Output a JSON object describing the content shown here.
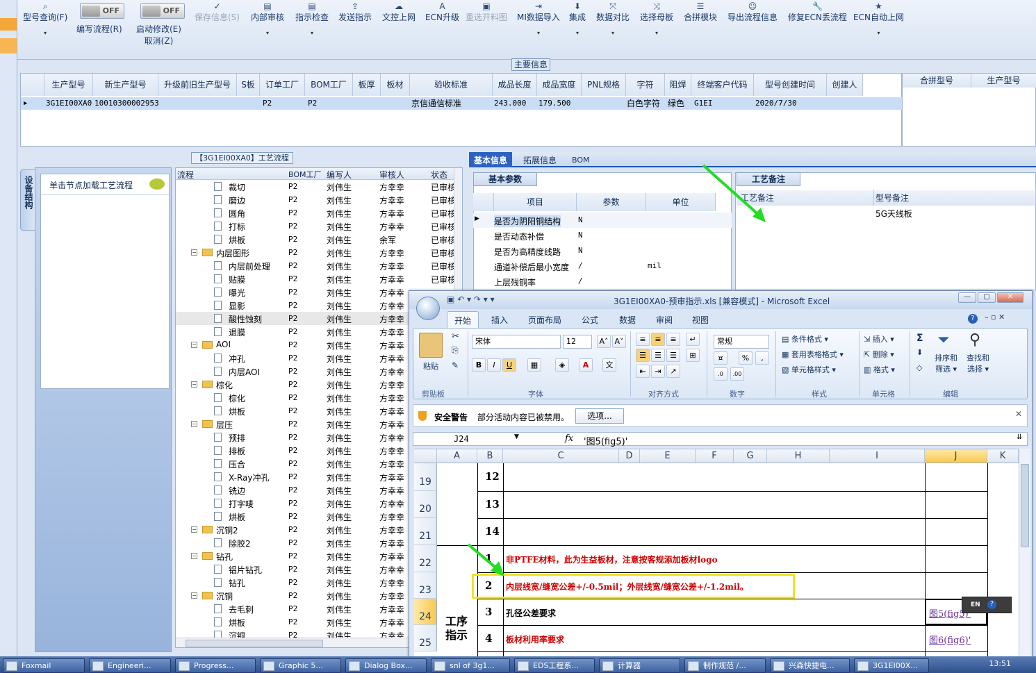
{
  "toolbar": {
    "items": [
      {
        "label": "型号查询(F)",
        "icon": "search-icon"
      },
      {
        "label": "编写流程(R)",
        "icon": "toggle"
      },
      {
        "label": "启动修改(E)",
        "sub": "取消(Z)",
        "icon": "toggle"
      },
      {
        "label": "保存信息(S)",
        "icon": "check-icon",
        "disabled": true
      },
      {
        "label": "内部审核",
        "icon": "print-icon"
      },
      {
        "label": "指示检查",
        "icon": "print-icon"
      },
      {
        "label": "发送指示",
        "icon": "upload-icon"
      },
      {
        "label": "文控上网",
        "icon": "cloud-icon"
      },
      {
        "label": "ECN升级",
        "icon": "letter-a-icon"
      },
      {
        "label": "重选开料图",
        "icon": "image-icon",
        "disabled": true
      },
      {
        "label": "MI数据导入",
        "icon": "import-icon"
      },
      {
        "label": "集成",
        "icon": "download-icon"
      },
      {
        "label": "数据对比",
        "icon": "compare-icon"
      },
      {
        "label": "选择母板",
        "icon": "shuffle-icon"
      },
      {
        "label": "合拼模块",
        "icon": "list-icon"
      },
      {
        "label": "导出流程信息",
        "icon": "smile-icon"
      },
      {
        "label": "修复ECN丢流程",
        "icon": "wrench-icon"
      },
      {
        "label": "ECN自动上网",
        "icon": "star-icon"
      }
    ],
    "toggle_off_label": "OFF"
  },
  "maininfo": {
    "caption": "主要信息",
    "headers": [
      "生产型号",
      "新生产型号",
      "升级前旧生产型号",
      "S板",
      "订单工厂",
      "BOM工厂",
      "板厚",
      "板材",
      "验收标准",
      "成品长度",
      "成品宽度",
      "PNL规格",
      "字符",
      "阻焊",
      "终端客户代码",
      "型号创建时间",
      "创建人"
    ],
    "row": [
      "3G1EI00XA0",
      "10010300002953",
      "",
      "",
      "P2",
      "P2",
      "",
      "",
      "京信通信标准",
      "243.000",
      "179.500",
      "",
      "白色字符",
      "绿色",
      "G1EI",
      "2020/7/30",
      ""
    ],
    "merge_headers": [
      "合拼型号",
      "生产型号"
    ]
  },
  "flow": {
    "caption": "【3G1EI00XA0】工艺流程",
    "vtab_label": "设备结构",
    "left_hint": "单击节点加载工艺流程",
    "headers": [
      "流程",
      "BOM工厂",
      "编写人",
      "审核人",
      "状态"
    ],
    "rows": [
      {
        "name": "裁切",
        "type": "file",
        "level": 2,
        "bom": "P2",
        "writer": "刘伟生",
        "reviewer": "方幸幸",
        "status": "已审核"
      },
      {
        "name": "磨边",
        "type": "file",
        "level": 2,
        "bom": "P2",
        "writer": "刘伟生",
        "reviewer": "方幸幸",
        "status": "已审核"
      },
      {
        "name": "圆角",
        "type": "file",
        "level": 2,
        "bom": "P2",
        "writer": "刘伟生",
        "reviewer": "方幸幸",
        "status": "已审核"
      },
      {
        "name": "打标",
        "type": "file",
        "level": 2,
        "bom": "P2",
        "writer": "刘伟生",
        "reviewer": "方幸幸",
        "status": "已审核"
      },
      {
        "name": "烘板",
        "type": "file",
        "level": 2,
        "bom": "P2",
        "writer": "刘伟生",
        "reviewer": "余军",
        "status": "已审核"
      },
      {
        "name": "内层图形",
        "type": "folder",
        "level": 1,
        "bom": "P2",
        "writer": "刘伟生",
        "reviewer": "方幸幸",
        "status": "已审核"
      },
      {
        "name": "内层前处理",
        "type": "file",
        "level": 2,
        "bom": "P2",
        "writer": "刘伟生",
        "reviewer": "方幸幸",
        "status": "已审核"
      },
      {
        "name": "贴膜",
        "type": "file",
        "level": 2,
        "bom": "P2",
        "writer": "刘伟生",
        "reviewer": "方幸幸",
        "status": "已审核"
      },
      {
        "name": "曝光",
        "type": "file",
        "level": 2,
        "bom": "P2",
        "writer": "刘伟生",
        "reviewer": "方幸幸",
        "status": ""
      },
      {
        "name": "显影",
        "type": "file",
        "level": 2,
        "bom": "P2",
        "writer": "刘伟生",
        "reviewer": "方幸幸",
        "status": ""
      },
      {
        "name": "酸性蚀刻",
        "type": "file",
        "level": 2,
        "bom": "P2",
        "writer": "刘伟生",
        "reviewer": "方幸幸",
        "status": "",
        "selected": true
      },
      {
        "name": "退膜",
        "type": "file",
        "level": 2,
        "bom": "P2",
        "writer": "刘伟生",
        "reviewer": "方幸幸",
        "status": ""
      },
      {
        "name": "AOI",
        "type": "folder",
        "level": 1,
        "bom": "P2",
        "writer": "刘伟生",
        "reviewer": "方幸幸",
        "status": ""
      },
      {
        "name": "冲孔",
        "type": "file",
        "level": 2,
        "bom": "P2",
        "writer": "刘伟生",
        "reviewer": "方幸幸",
        "status": ""
      },
      {
        "name": "内层AOI",
        "type": "file",
        "level": 2,
        "bom": "P2",
        "writer": "刘伟生",
        "reviewer": "方幸幸",
        "status": ""
      },
      {
        "name": "棕化",
        "type": "folder",
        "level": 1,
        "bom": "P2",
        "writer": "刘伟生",
        "reviewer": "方幸幸",
        "status": ""
      },
      {
        "name": "棕化",
        "type": "file",
        "level": 2,
        "bom": "P2",
        "writer": "刘伟生",
        "reviewer": "方幸幸",
        "status": ""
      },
      {
        "name": "烘板",
        "type": "file",
        "level": 2,
        "bom": "P2",
        "writer": "刘伟生",
        "reviewer": "方幸幸",
        "status": ""
      },
      {
        "name": "层压",
        "type": "folder",
        "level": 1,
        "bom": "P2",
        "writer": "刘伟生",
        "reviewer": "方幸幸",
        "status": ""
      },
      {
        "name": "预排",
        "type": "file",
        "level": 2,
        "bom": "P2",
        "writer": "刘伟生",
        "reviewer": "方幸幸",
        "status": ""
      },
      {
        "name": "排板",
        "type": "file",
        "level": 2,
        "bom": "P2",
        "writer": "刘伟生",
        "reviewer": "方幸幸",
        "status": ""
      },
      {
        "name": "压合",
        "type": "file",
        "level": 2,
        "bom": "P2",
        "writer": "刘伟生",
        "reviewer": "方幸幸",
        "status": ""
      },
      {
        "name": "X-Ray冲孔",
        "type": "file",
        "level": 2,
        "bom": "P2",
        "writer": "刘伟生",
        "reviewer": "方幸幸",
        "status": ""
      },
      {
        "name": "铣边",
        "type": "file",
        "level": 2,
        "bom": "P2",
        "writer": "刘伟生",
        "reviewer": "方幸幸",
        "status": ""
      },
      {
        "name": "打字唛",
        "type": "file",
        "level": 2,
        "bom": "P2",
        "writer": "刘伟生",
        "reviewer": "方幸幸",
        "status": ""
      },
      {
        "name": "烘板",
        "type": "file",
        "level": 2,
        "bom": "P2",
        "writer": "刘伟生",
        "reviewer": "方幸幸",
        "status": ""
      },
      {
        "name": "沉铜2",
        "type": "folder",
        "level": 1,
        "bom": "P2",
        "writer": "刘伟生",
        "reviewer": "方幸幸",
        "status": ""
      },
      {
        "name": "除胶2",
        "type": "file",
        "level": 2,
        "bom": "P2",
        "writer": "刘伟生",
        "reviewer": "方幸幸",
        "status": ""
      },
      {
        "name": "钻孔",
        "type": "folder",
        "level": 1,
        "bom": "P2",
        "writer": "刘伟生",
        "reviewer": "方幸幸",
        "status": ""
      },
      {
        "name": "铝片钻孔",
        "type": "file",
        "level": 2,
        "bom": "P2",
        "writer": "刘伟生",
        "reviewer": "方幸幸",
        "status": ""
      },
      {
        "name": "钻孔",
        "type": "file",
        "level": 2,
        "bom": "P2",
        "writer": "刘伟生",
        "reviewer": "方幸幸",
        "status": ""
      },
      {
        "name": "沉铜",
        "type": "folder",
        "level": 1,
        "bom": "P2",
        "writer": "刘伟生",
        "reviewer": "方幸幸",
        "status": ""
      },
      {
        "name": "去毛刺",
        "type": "file",
        "level": 2,
        "bom": "P2",
        "writer": "刘伟生",
        "reviewer": "方幸幸",
        "status": ""
      },
      {
        "name": "烘板",
        "type": "file",
        "level": 2,
        "bom": "P2",
        "writer": "刘伟生",
        "reviewer": "方幸幸",
        "status": ""
      },
      {
        "name": "沉铜",
        "type": "file",
        "level": 2,
        "bom": "P2",
        "writer": "刘伟生",
        "reviewer": "方幸幸",
        "status": ""
      }
    ]
  },
  "right": {
    "tabs": [
      "基本信息",
      "拓展信息",
      "BOM"
    ],
    "basic_caption": "基本参数",
    "param_headers": [
      "项目",
      "参数",
      "单位"
    ],
    "params": [
      {
        "item": "是否为阴阳铜结构",
        "value": "N",
        "unit": ""
      },
      {
        "item": "是否动态补偿",
        "value": "N",
        "unit": ""
      },
      {
        "item": "是否为高精度线路",
        "value": "N",
        "unit": ""
      },
      {
        "item": "通道补偿后最小宽度",
        "value": "/",
        "unit": "mil"
      },
      {
        "item": "上层残铜率",
        "value": "/",
        "unit": ""
      }
    ],
    "craft_caption": "工艺备注",
    "craft_headers": [
      "工艺备注",
      "型号备注"
    ],
    "model_note": "5G天线板"
  },
  "excel": {
    "title": "3G1EI00XA0-预审指示.xls  [兼容模式] - Microsoft Excel",
    "tabs": [
      "开始",
      "插入",
      "页面布局",
      "公式",
      "数据",
      "审阅",
      "视图"
    ],
    "ribbon": {
      "paste": "粘贴",
      "clipboard": "剪贴板",
      "font_name": "宋体",
      "font_size": "12",
      "font_group": "字体",
      "align_group": "对齐方式",
      "number_format": "常规",
      "number_group": "数字",
      "cond_format": "条件格式",
      "table_format": "套用表格格式",
      "cell_style": "单元格样式",
      "style_group": "样式",
      "insert": "插入",
      "delete": "删除",
      "format": "格式",
      "cells_group": "单元格",
      "sort_filter": "排序和",
      "sort_filter2": "筛选",
      "find_select": "查找和",
      "find_select2": "选择",
      "edit_group": "编辑",
      "bold": "B",
      "italic": "I",
      "underline": "U"
    },
    "security": {
      "title": "安全警告",
      "message": "部分活动内容已被禁用。",
      "button": "选项..."
    },
    "namebox": "J24",
    "formula": "'图5(fig5)'",
    "columns": [
      "A",
      "B",
      "C",
      "D",
      "E",
      "F",
      "G",
      "H",
      "I",
      "J",
      "K"
    ],
    "rows": [
      {
        "rownum": "19",
        "num": "12",
        "text": "",
        "link": ""
      },
      {
        "rownum": "20",
        "num": "13",
        "text": "",
        "link": ""
      },
      {
        "rownum": "21",
        "num": "14",
        "text": "",
        "link": ""
      },
      {
        "rownum": "22",
        "num": "1",
        "text": "非PTFE材料，此为生益板材，注意按客规添加板材logo",
        "link": "",
        "red": true
      },
      {
        "rownum": "23",
        "num": "2",
        "text": "内层线宽/缝宽公差+/-0.5mil；外层线宽/缝宽公差+/-1.2mil。",
        "link": "",
        "red": true
      },
      {
        "rownum": "24",
        "num": "3",
        "text": "孔径公差要求",
        "link": "图5(fig5)'",
        "red": false
      },
      {
        "rownum": "25",
        "num": "4",
        "text": "板材利用率要求",
        "link": "图6(fig6)'",
        "red": true
      }
    ],
    "section_label_1": "工序",
    "section_label_2": "指示",
    "ime": "EN"
  },
  "taskbar": {
    "items": [
      "Foxmail",
      "Engineeri...",
      "Progress...",
      "Graphic 5...",
      "Dialog Box...",
      "snl of 3g1...",
      "EDS工程系...",
      "计算器",
      "制作规范 /...",
      "兴森快捷电...",
      "3G1EI00X..."
    ],
    "clock": "13:51"
  },
  "colors": {
    "accent": "#2d63c0",
    "warn_red": "#d10000",
    "highlight_yellow": "#f0e22a",
    "arrow_green": "#22dd22"
  }
}
